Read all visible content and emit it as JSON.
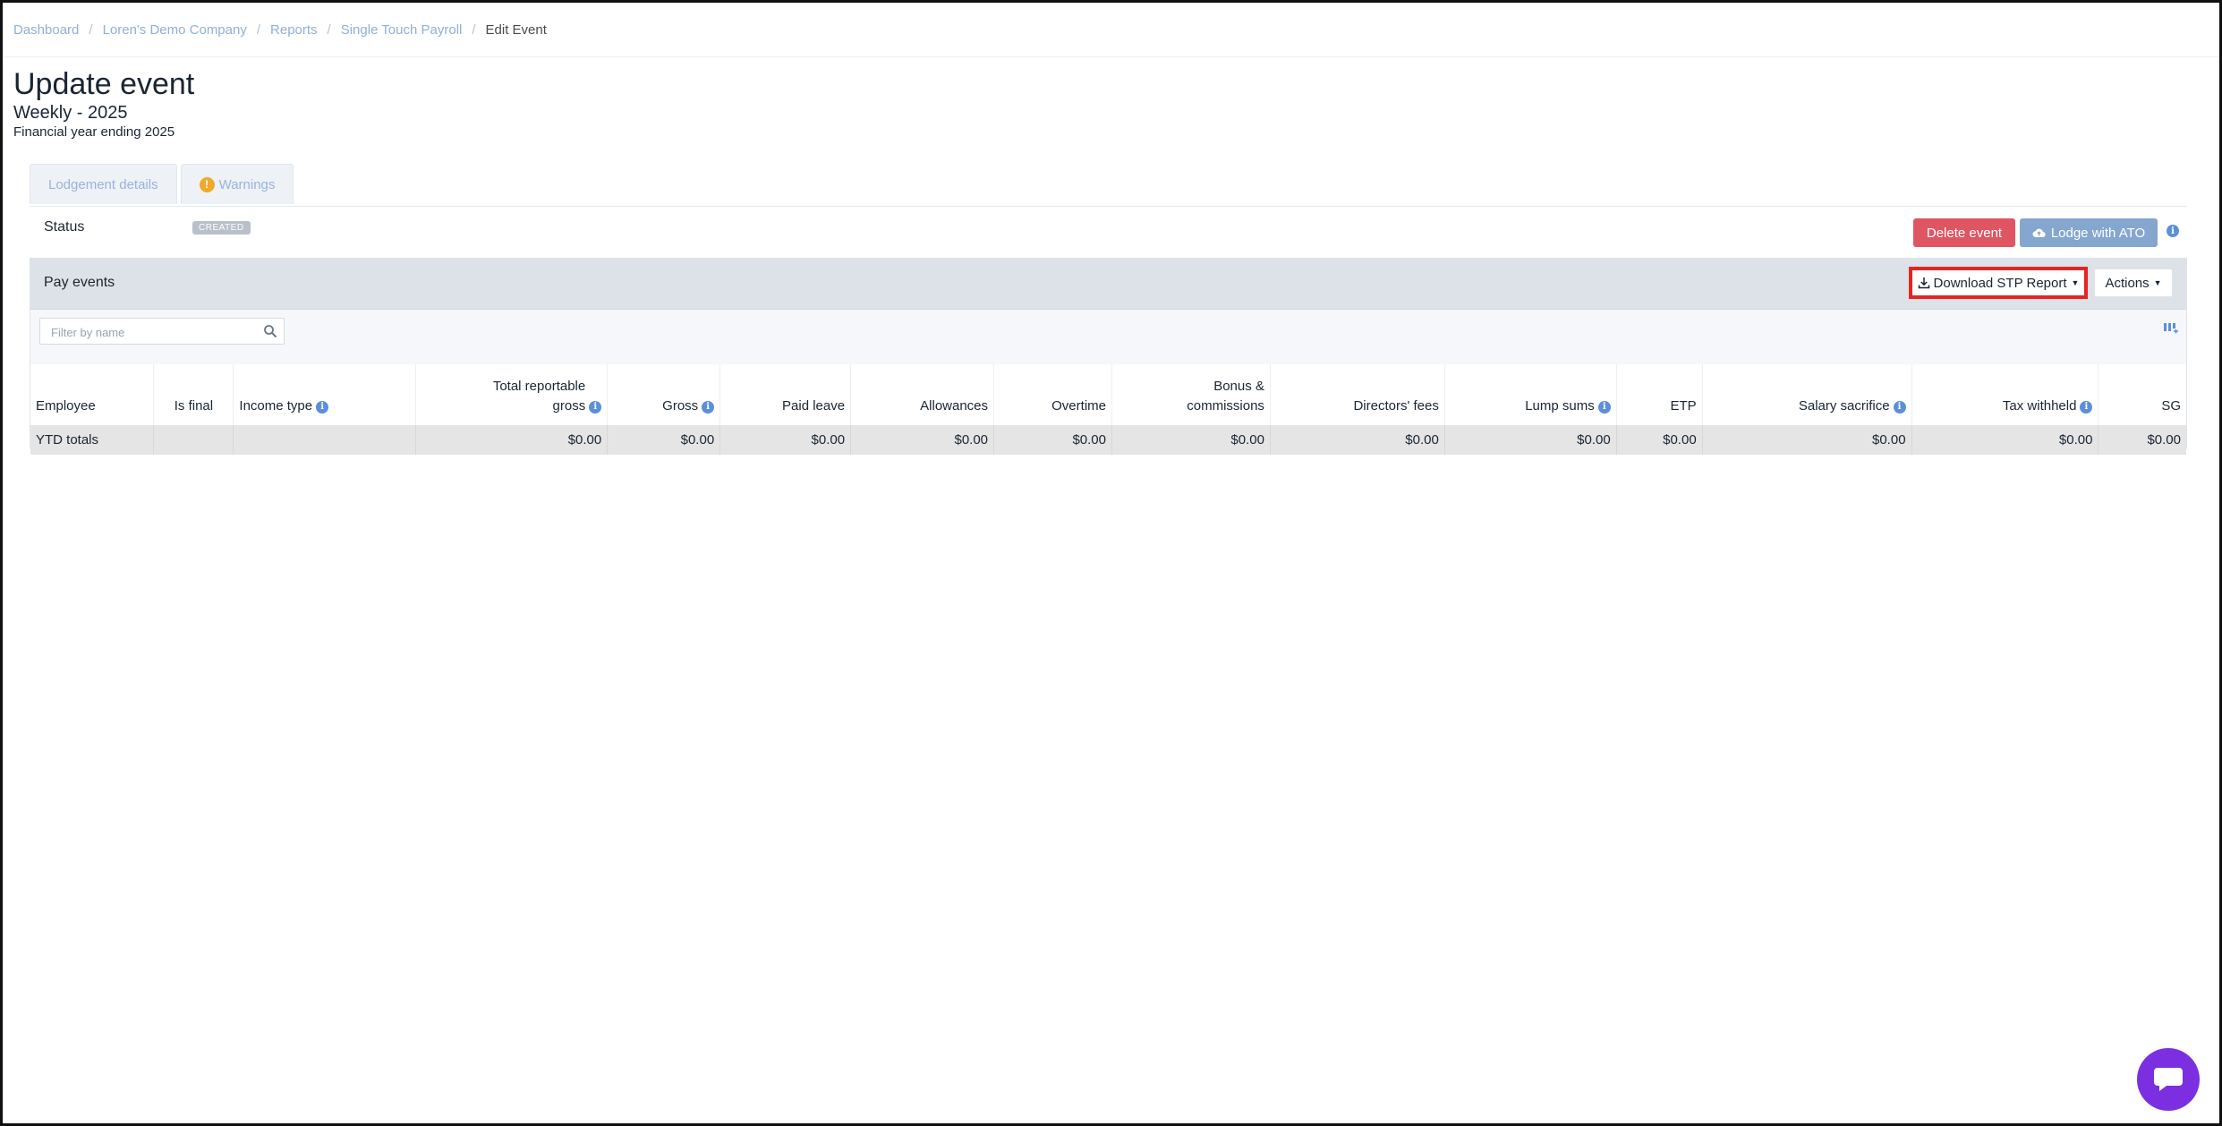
{
  "breadcrumb": [
    "Dashboard",
    "Loren's Demo Company",
    "Reports",
    "Single Touch Payroll",
    "Edit Event"
  ],
  "page": {
    "title": "Update event",
    "subtitle": "Weekly - 2025",
    "financial_year": "Financial year ending 2025"
  },
  "tabs": [
    {
      "label": "Lodgement details"
    },
    {
      "label": "Warnings",
      "badge": "!"
    }
  ],
  "status": {
    "label": "Status",
    "value": "CREATED"
  },
  "buttons": {
    "delete": "Delete event",
    "lodge": "Lodge with ATO",
    "download": "Download STP Report",
    "actions": "Actions"
  },
  "pay_events": {
    "title": "Pay events",
    "filter_placeholder": "Filter by name"
  },
  "table": {
    "columns": [
      "Employee",
      "Is final",
      "Income type",
      "Total reportable gross",
      "Gross",
      "Paid leave",
      "Allowances",
      "Overtime",
      "Bonus & commissions",
      "Directors' fees",
      "Lump sums",
      "ETP",
      "Salary sacrifice",
      "Tax withheld",
      "SG"
    ],
    "rows": [
      [
        "YTD totals",
        "",
        "",
        "$0.00",
        "$0.00",
        "$0.00",
        "$0.00",
        "$0.00",
        "$0.00",
        "$0.00",
        "$0.00",
        "$0.00",
        "$0.00",
        "$0.00",
        "$0.00"
      ]
    ]
  },
  "colors": {
    "delete": "#df5562",
    "lodge": "#84a6cf",
    "highlight": "#e52421",
    "chat": "#7b2fe0",
    "warning": "#f0a92b"
  },
  "icons": [
    "download-icon",
    "cloud-upload-icon",
    "info-icon",
    "search-icon",
    "columns-icon",
    "chat-icon",
    "warning-icon"
  ]
}
